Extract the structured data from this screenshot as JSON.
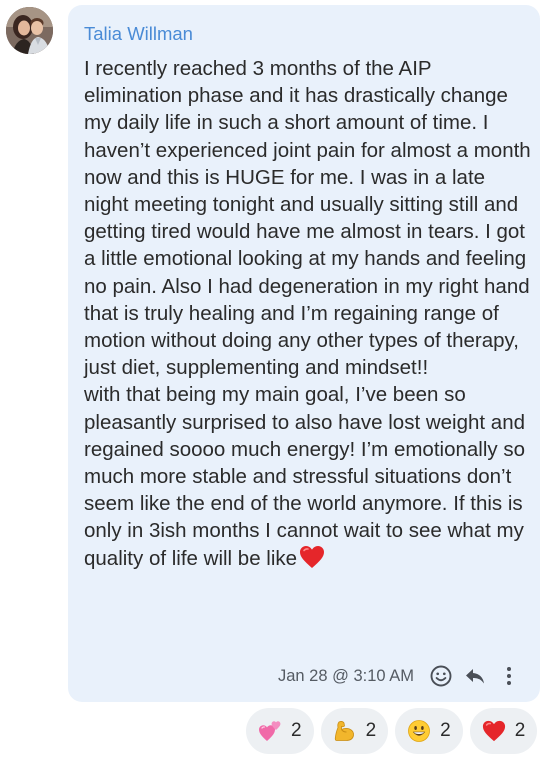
{
  "message": {
    "sender": "Talia Willman",
    "body": "I recently reached 3 months of the AIP elimination phase and it has drastically change my daily life in such a short amount of time. I haven’t experienced joint pain for almost a month now and this is HUGE for me. I was in a late night meeting tonight and usually sitting still and getting tired would have me almost in tears. I got a little emotional looking at my hands and feeling no pain. Also I had degeneration in my right hand that is truly healing and I’m regaining range of motion without doing any other types of therapy, just diet, supplementing and mindset!!\nwith that being my main goal, I’ve been so pleasantly surprised to also have lost weight and regained soooo much energy! I’m emotionally so much more stable and stressful situations don’t seem like the end of the world anymore. If this is only in 3ish months I cannot wait to see what my quality of life will be like",
    "trailing_emoji": "red-heart-emoji",
    "timestamp": "Jan 28 @ 3:10 AM"
  },
  "actions": {
    "react_icon": "smiley-icon",
    "reply_icon": "reply-arrow-icon",
    "more_icon": "vertical-dots-icon"
  },
  "reactions": [
    {
      "emoji": "pink-hearts-emoji",
      "count": "2"
    },
    {
      "emoji": "flexed-biceps-emoji",
      "count": "2"
    },
    {
      "emoji": "grinning-face-emoji",
      "count": "2"
    },
    {
      "emoji": "red-heart-emoji",
      "count": "2"
    }
  ],
  "colors": {
    "bubble_bg": "#e9f1fb",
    "sender_name": "#4a8bd6",
    "text": "#2b2b2b",
    "timestamp": "#555b63",
    "reaction_bg": "#edf0f3"
  }
}
